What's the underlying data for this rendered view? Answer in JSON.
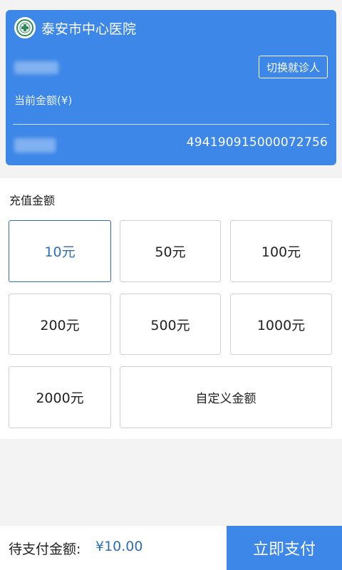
{
  "header": {
    "hospital_name": "泰安市中心医院",
    "switch_patient_label": "切换就诊人",
    "balance_label": "当前金额(¥)",
    "card_number": "494190915000072756"
  },
  "recharge": {
    "title": "充值金额",
    "options": [
      "10元",
      "50元",
      "100元",
      "200元",
      "500元",
      "1000元",
      "2000元"
    ],
    "custom_label": "自定义金额",
    "selected": "10元"
  },
  "footer": {
    "pay_label": "待支付金额:",
    "pay_amount": "¥10.00",
    "pay_button": "立即支付"
  },
  "colors": {
    "accent": "#3d87e8",
    "selected_text": "#2f6db5"
  }
}
